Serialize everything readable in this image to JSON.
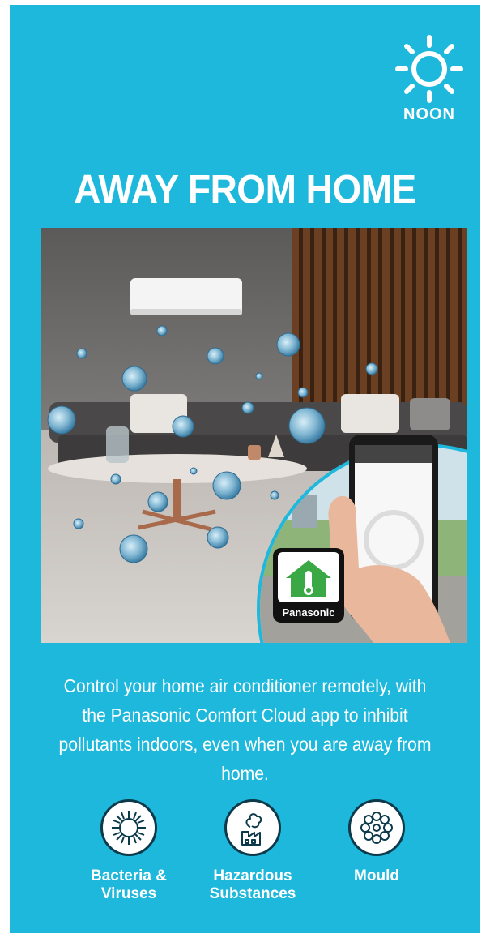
{
  "header": {
    "time_of_day": "NOON",
    "icon": "sun-icon"
  },
  "title": "AWAY FROM HOME",
  "scene": {
    "brand_badge": "Panasonic",
    "app_icon": "home-thermometer-icon"
  },
  "description": "Control your home air conditioner remotely, with the Panasonic Comfort Cloud app to inhibit pollutants indoors, even when you are away from home.",
  "pollutants": [
    {
      "label": "Bacteria &\nViruses",
      "icon": "virus-icon"
    },
    {
      "label": "Hazardous\nSubstances",
      "icon": "factory-smoke-icon"
    },
    {
      "label": "Mould",
      "icon": "mould-icon"
    }
  ],
  "colors": {
    "background": "#1eb8dc",
    "icon_outline": "#0d3a4a",
    "app_green": "#3aa845"
  }
}
